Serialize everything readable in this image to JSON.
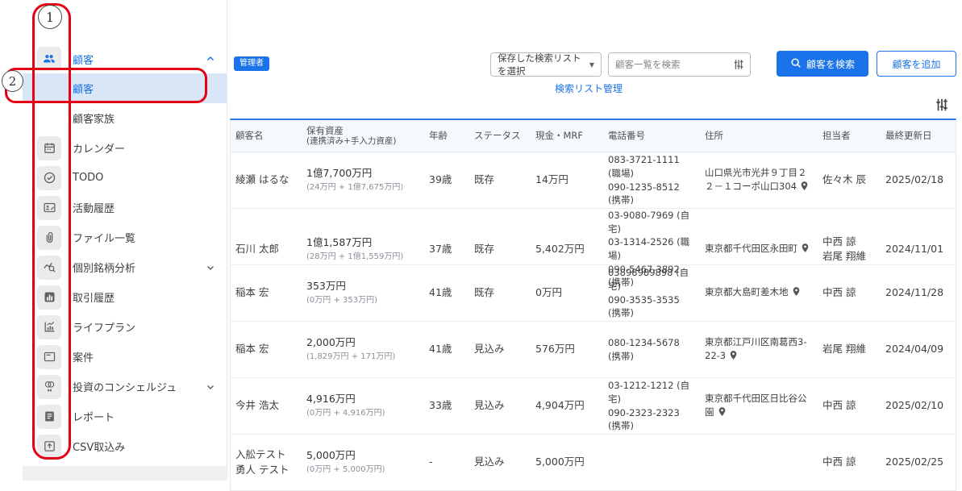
{
  "annotations": {
    "one": "1",
    "two": "2"
  },
  "colors": {
    "accent": "#1a73e8",
    "annotation_red": "#e60014",
    "selected_bg": "#d8e6f8",
    "table_top_border": "#2979e8"
  },
  "sidebar": {
    "parent": {
      "label": "顧客",
      "icon": "people-icon",
      "state": "expanded"
    },
    "submenu": [
      {
        "label": "顧客",
        "selected": true
      },
      {
        "label": "顧客家族",
        "selected": false
      }
    ],
    "items": [
      {
        "label": "カレンダー",
        "icon": "calendar-icon"
      },
      {
        "label": "TODO",
        "icon": "todo-check-icon"
      },
      {
        "label": "活動履歴",
        "icon": "activity-history-icon"
      },
      {
        "label": "ファイル一覧",
        "icon": "paperclip-icon"
      },
      {
        "label": "個別銘柄分析",
        "icon": "stock-analysis-icon",
        "chevron": "down"
      },
      {
        "label": "取引履歴",
        "icon": "transaction-history-icon"
      },
      {
        "label": "ライフプラン",
        "icon": "lifeplan-chart-icon"
      },
      {
        "label": "案件",
        "icon": "case-icon"
      },
      {
        "label": "投資のコンシェルジュ",
        "icon": "concierge-icon",
        "chevron": "down"
      },
      {
        "label": "レポート",
        "icon": "report-icon"
      },
      {
        "label": "CSV取込み",
        "icon": "csv-import-icon"
      }
    ]
  },
  "toolbar": {
    "admin_badge": "管理者",
    "saved_search_select": "保存した検索リストを選択",
    "search_placeholder": "顧客一覧を検索",
    "search_button": "顧客を検索",
    "add_button": "顧客を追加",
    "search_list_link": "検索リスト管理"
  },
  "table": {
    "headers": {
      "name": "顧客名",
      "assets": "保有資産",
      "assets_sub": "(連携済み+手入力資産)",
      "age": "年齢",
      "status": "ステータス",
      "cash": "現金・MRF",
      "phone": "電話番号",
      "address": "住所",
      "staff": "担当者",
      "updated": "最終更新日"
    },
    "rows": [
      {
        "name": "綾瀬 はるな",
        "assets": "1億7,700万円",
        "assets_sub": "(24万円 + 1億7,675万円)",
        "age": "39歳",
        "status": "既存",
        "cash": "14万円",
        "phones": [
          "083-3721-1111 (職場)",
          "090-1235-8512 (携帯)"
        ],
        "address": "山口県光市光井９丁目２２－１コーポ山口304",
        "staff": [
          "佐々木 辰"
        ],
        "updated": "2025/02/18"
      },
      {
        "name": "石川 太郎",
        "assets": "1億1,587万円",
        "assets_sub": "(28万円 + 1億1,559万円)",
        "age": "37歳",
        "status": "既存",
        "cash": "5,402万円",
        "phones": [
          "03-9080-7969 (自宅)",
          "03-1314-2526 (職場)",
          "090-5467-3892 (携帯)"
        ],
        "address": "東京都千代田区永田町",
        "staff": [
          "中西 諒",
          "岩尾 翔維"
        ],
        "updated": "2024/11/01"
      },
      {
        "name": "稲本 宏",
        "assets": "353万円",
        "assets_sub": "(0万円 + 353万円)",
        "age": "41歳",
        "status": "既存",
        "cash": "0万円",
        "phones": [
          "03898989898 (自宅)",
          "090-3535-3535 (携帯)"
        ],
        "address": "東京都大島町差木地",
        "staff": [
          "中西 諒"
        ],
        "updated": "2024/11/28"
      },
      {
        "name": "稲本 宏",
        "assets": "2,000万円",
        "assets_sub": "(1,829万円 + 171万円)",
        "age": "41歳",
        "status": "見込み",
        "cash": "576万円",
        "phones": [
          "080-1234-5678 (携帯)"
        ],
        "address": "東京都江戸川区南葛西3-22-3",
        "staff": [
          "岩尾 翔維"
        ],
        "updated": "2024/04/09"
      },
      {
        "name": "今井 浩太",
        "assets": "4,916万円",
        "assets_sub": "(0万円 + 4,916万円)",
        "age": "33歳",
        "status": "見込み",
        "cash": "4,904万円",
        "phones": [
          "03-1212-1212 (自宅)",
          "090-2323-2323 (携帯)"
        ],
        "address": "東京都千代田区日比谷公園",
        "staff": [
          "中西 諒"
        ],
        "updated": "2025/02/10"
      },
      {
        "name": "入舩テスト 勇人 テスト",
        "assets": "5,000万円",
        "assets_sub": "(0万円 + 5,000万円)",
        "age": "-",
        "status": "見込み",
        "cash": "5,000万円",
        "phones": [],
        "address": "",
        "staff": [
          "中西 諒"
        ],
        "updated": "2025/02/25"
      }
    ]
  }
}
